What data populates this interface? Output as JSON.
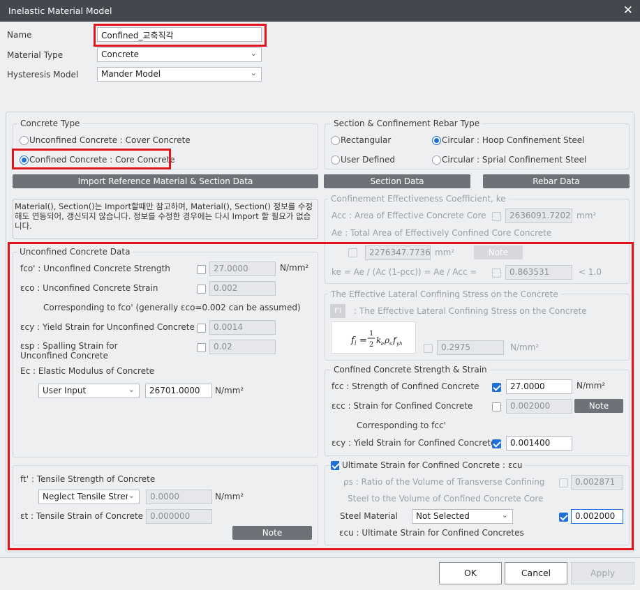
{
  "window": {
    "title": "Inelastic Material Model",
    "close": "✕"
  },
  "form": {
    "name_label": "Name",
    "name_value": "Confined_교축직각",
    "material_type_label": "Material Type",
    "material_type_value": "Concrete",
    "hysteresis_label": "Hysteresis Model",
    "hysteresis_value": "Mander Model"
  },
  "concrete_type": {
    "title": "Concrete Type",
    "opt_unconfined": "Unconfined Concrete : Cover Concrete",
    "opt_confined": "Confined Concrete : Core Concrete",
    "selected": "confined"
  },
  "section_type": {
    "title": "Section & Confinement Rebar Type",
    "opt_rect": "Rectangular",
    "opt_hoop": "Circular : Hoop Confinement Steel",
    "opt_user": "User Defined",
    "opt_spiral": "Circular : Sprial Confinement Steel",
    "selected": "hoop"
  },
  "buttons": {
    "import": "Import Reference Material & Section Data",
    "section_data": "Section Data",
    "rebar_data": "Rebar Data",
    "note": "Note",
    "ok": "OK",
    "cancel": "Cancel",
    "apply": "Apply"
  },
  "info_text": "Material(), Section()는 Import할때만 참고하며, Material(), Section() 정보를 수정해도 연동되어, 갱신되지 않습니다. 정보를 수정한 경우에는 다시 Import 할 필요가 없습니다.",
  "ke": {
    "title": "Confinement Effectiveness Coefficient, ke",
    "acc_label": "Acc : Area of Effective Concrete Core",
    "acc_value": "2636091.7202",
    "unit_mm2": "mm²",
    "ae_label": "Ae : Total Area of Effectively Confined Core Concrete",
    "ae_value": "2276347.7736",
    "ke_label": "ke = Ae / (Ac (1-pcc)) = Ae / Acc =",
    "ke_value": "0.863531",
    "ke_limit": "< 1.0"
  },
  "unconfined": {
    "title": "Unconfined Concrete Data",
    "fco_label": "fco' : Unconfined Concrete Strength",
    "fco_value": "27.0000",
    "unit_stress": "N/mm²",
    "eco_label": "εco : Unconfined Concrete Strain",
    "eco_value": "0.002",
    "eco_note": "Corresponding to fco' (generally εco=0.002 can be assumed)",
    "ecy_label": "εcy : Yield Strain for Unconfined Concrete",
    "ecy_value": "0.0014",
    "esp_label": "εsp : Spalling Strain for Unconfined Concrete",
    "esp_value": "0.02",
    "ec_label": "Ec : Elastic Modulus of Concrete",
    "ec_mode": "User Input",
    "ec_value": "26701.0000"
  },
  "tensile": {
    "ft_label": "ft' : Tensile Strength of Concrete",
    "ft_mode": "Neglect Tensile Strength",
    "ft_value": "0.0000",
    "et_label": "εt : Tensile Strain of Concrete",
    "et_value": "0.000000"
  },
  "lateral": {
    "title": "The Effective Lateral Confining Stress on the Concrete",
    "fl_badge": "f'l",
    "fl_label": ": The Effective Lateral Confining Stress on the Concrete",
    "fl_value": "0.2975"
  },
  "confined": {
    "title": "Confined Concrete Strength & Strain",
    "fcc_label": "fcc : Strength of Confined Concrete",
    "fcc_value": "27.0000",
    "ecc_label": "εcc : Strain for Confined Concrete",
    "ecc_value": "0.002000",
    "ecc_note": "Corresponding to fcc'",
    "ecy_label": "εcy : Yield Strain for Confined Concrete",
    "ecy_value": "0.001400"
  },
  "ultimate": {
    "title": "Ultimate Strain for Confined Concrete : εcu",
    "ps_label": "ρs : Ratio of the Volume of Transverse Confining",
    "ps_label2": "Steel  to the Volume of Confined Concrete Core",
    "ps_value": "0.002871",
    "steel_label": "Steel Material",
    "steel_value": "Not Selected",
    "ecu_value": "0.002000",
    "ecu_label": "εcu : Ultimate Strain for Confined Concretes"
  },
  "colors": {
    "highlight": "#e3151c",
    "accent": "#1f6fd6",
    "titlebar": "#44474d"
  }
}
